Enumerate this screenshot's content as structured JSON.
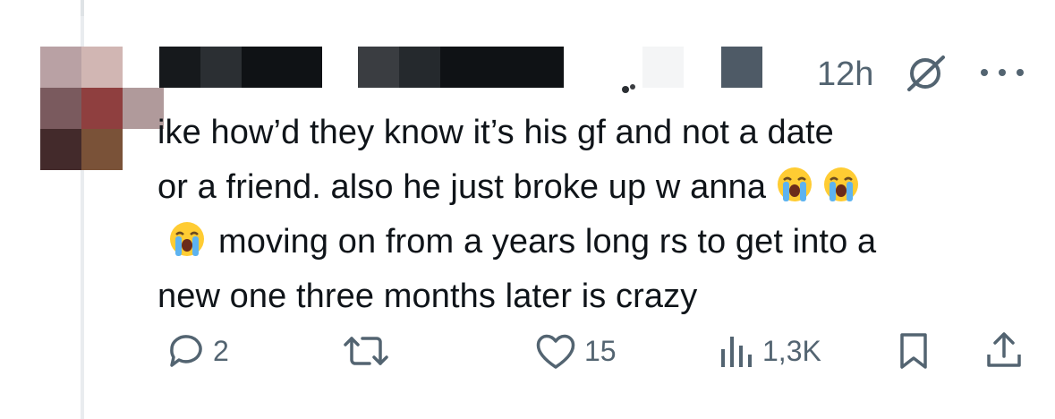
{
  "tweet": {
    "time": "12h",
    "text_lines": [
      "ike how’d they know it’s his gf and not a date",
      "or a friend. also he just broke up w anna",
      "moving on from a years long rs to get into a",
      "new one three months later is crazy"
    ],
    "emoji_icon": "loudly-crying-face"
  },
  "actions": {
    "replies": "2",
    "likes": "15",
    "views": "1,3K"
  },
  "colors": {
    "text": "#0f1419",
    "secondary": "#536471",
    "thread_line": "#e9ecef"
  }
}
